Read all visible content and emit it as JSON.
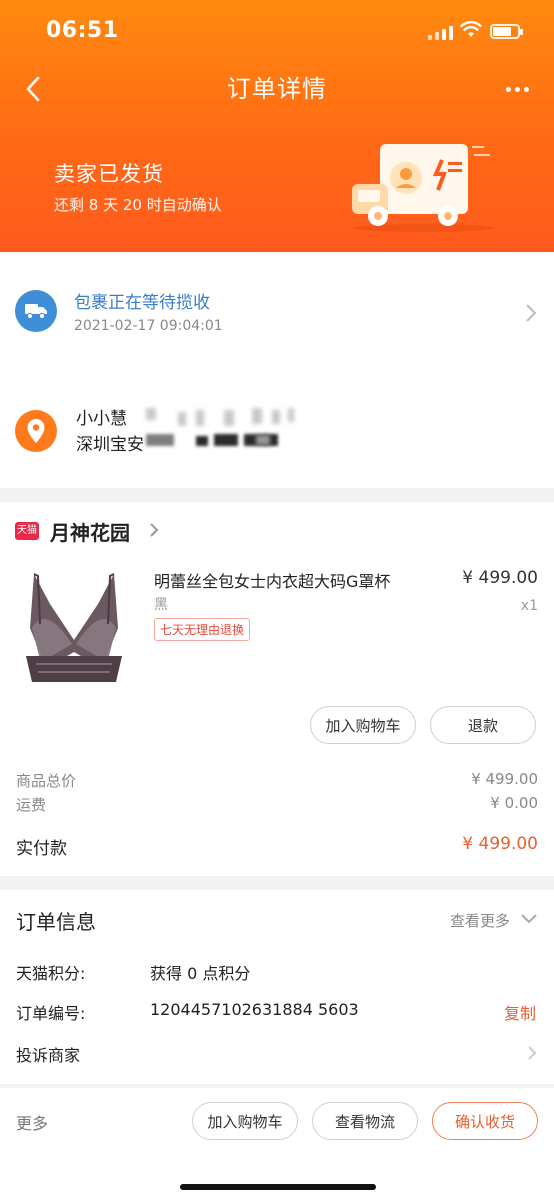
{
  "status_bar": {
    "time": "06:51"
  },
  "nav": {
    "title": "订单详情"
  },
  "shipping": {
    "status": "卖家已发货",
    "countdown": "还剩 8 天 20 时自动确认"
  },
  "logistics": {
    "status": "包裹正在等待揽收",
    "time": "2021-02-17 09:04:01"
  },
  "address": {
    "name": "小小慧",
    "line": "深圳宝安"
  },
  "shop": {
    "badge": "天猫",
    "name": "月神花园"
  },
  "product": {
    "title": "明蕾丝全包女士内衣超大码G罩杯",
    "price": "¥ 499.00",
    "variant": "黑",
    "quantity": "x1",
    "tag": "七天无理由退换"
  },
  "item_actions": {
    "add_to_cart": "加入购物车",
    "refund": "退款"
  },
  "summary": {
    "goods_total_label": "商品总价",
    "goods_total_value": "¥ 499.00",
    "shipping_label": "运费",
    "shipping_value": "¥ 0.00",
    "paid_label": "实付款",
    "paid_value": "¥ 499.00"
  },
  "order_info": {
    "title": "订单信息",
    "see_more": "查看更多",
    "points_label": "天猫积分:",
    "points_value": "获得 0 点积分",
    "order_no_label": "订单编号:",
    "order_no_value": "1204457102631884 5603",
    "copy": "复制",
    "complain": "投诉商家"
  },
  "bottom_bar": {
    "more": "更多",
    "add_to_cart": "加入购物车",
    "view_logistics": "查看物流",
    "confirm_receipt": "确认收货"
  },
  "colors": {
    "accent": "#ff6a14",
    "link_blue": "#3b7dc8",
    "price_orange": "#e86030"
  },
  "icons": [
    "back-icon",
    "more-icon",
    "truck-icon",
    "location-pin-icon",
    "chevron-right-icon",
    "chevron-down-icon",
    "tmall-icon"
  ]
}
